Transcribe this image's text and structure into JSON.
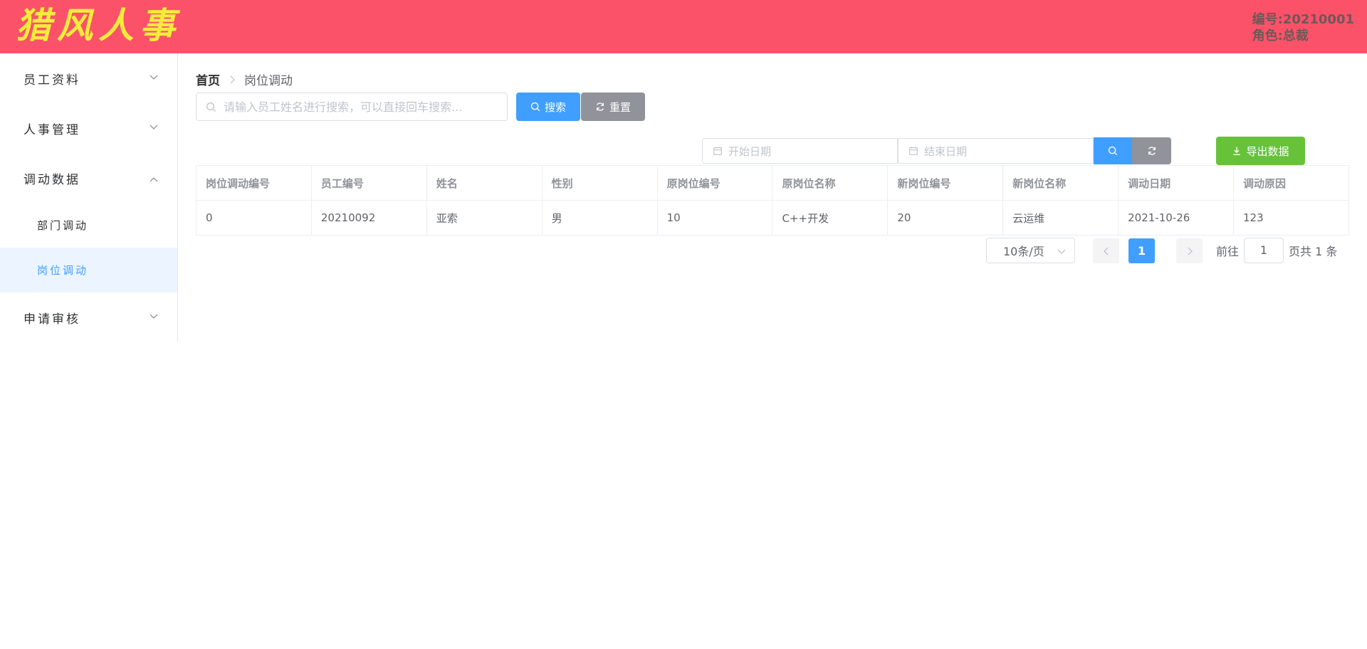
{
  "header": {
    "logo_text": "猎风人事",
    "user_id": "编号:20210001",
    "user_role": "角色:总裁",
    "bg_color": "#fc5269",
    "logo_color": "#f4ec3c"
  },
  "sidebar": {
    "menus": [
      {
        "label": "员工资料",
        "expanded": false
      },
      {
        "label": "人事管理",
        "expanded": false
      },
      {
        "label": "调动数据",
        "expanded": true,
        "children": [
          {
            "label": "部门调动",
            "active": false
          },
          {
            "label": "岗位调动",
            "active": true
          }
        ]
      },
      {
        "label": "申请审核",
        "expanded": false
      }
    ]
  },
  "breadcrumb": {
    "home": "首页",
    "current": "岗位调动"
  },
  "search": {
    "placeholder": "请输入员工姓名进行搜索，可以直接回车搜索...",
    "value": "",
    "search_label": "搜索",
    "reset_label": "重置"
  },
  "date_filter": {
    "start_placeholder": "开始日期",
    "end_placeholder": "结束日期",
    "export_label": "导出数据"
  },
  "table": {
    "columns": [
      "岗位调动编号",
      "员工编号",
      "姓名",
      "性别",
      "原岗位编号",
      "原岗位名称",
      "新岗位编号",
      "新岗位名称",
      "调动日期",
      "调动原因"
    ],
    "rows": [
      [
        "0",
        "20210092",
        "亚索",
        "男",
        "10",
        "C++开发",
        "20",
        "云运维",
        "2021-10-26",
        "123"
      ]
    ]
  },
  "pagination": {
    "page_size": "10条/页",
    "current_page": "1",
    "goto_prefix": "前往",
    "goto_value": "1",
    "goto_suffix": "页",
    "total_text": "共 1 条"
  },
  "colors": {
    "primary": "#409eff",
    "info": "#909399",
    "success": "#67c23a"
  }
}
